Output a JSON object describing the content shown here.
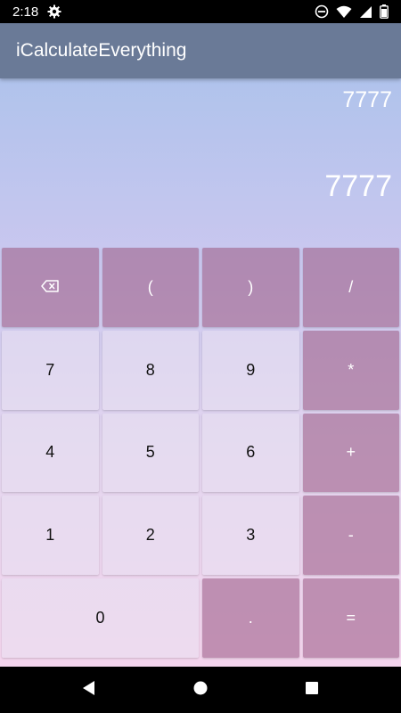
{
  "status_bar": {
    "time": "2:18",
    "icons": [
      "settings-icon",
      "do-not-disturb-icon",
      "wifi-icon",
      "signal-icon",
      "battery-icon"
    ]
  },
  "app_bar": {
    "title": "iCalculateEverything"
  },
  "display": {
    "expression": "7777",
    "result": "7777"
  },
  "keypad": {
    "backspace_icon": "backspace-icon",
    "open_paren": "(",
    "close_paren": ")",
    "divide": "/",
    "seven": "7",
    "eight": "8",
    "nine": "9",
    "multiply": "*",
    "four": "4",
    "five": "5",
    "six": "6",
    "plus": "+",
    "one": "1",
    "two": "2",
    "three": "3",
    "minus": "-",
    "zero": "0",
    "dot": ".",
    "equals": "="
  },
  "nav_bar": {
    "icons": [
      "back-icon",
      "home-icon",
      "recents-icon"
    ]
  },
  "colors": {
    "app_bar": "#6a7a97",
    "operator_key": "#b088a8",
    "gradient_top": "#b0c3ec",
    "gradient_bottom": "#f5d5ee"
  }
}
